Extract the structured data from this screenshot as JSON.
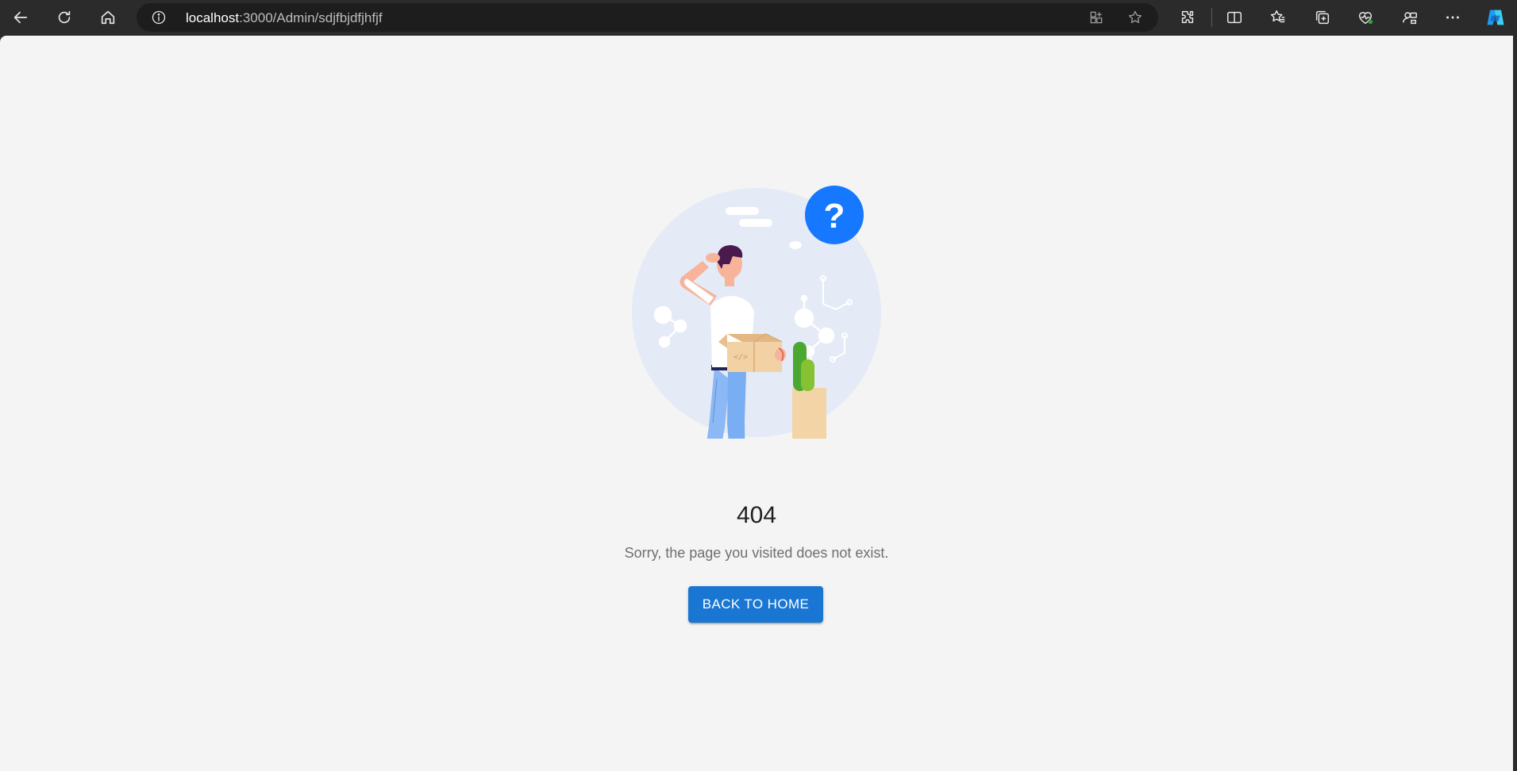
{
  "browser": {
    "url_host": "localhost",
    "url_path": ":3000/Admin/sdjfbjdfjhfjf",
    "toolbar_icons": [
      "back-icon",
      "refresh-icon",
      "home-icon",
      "info-icon",
      "app-available-icon",
      "favorite-star-icon",
      "extensions-icon",
      "split-screen-icon",
      "favorites-icon",
      "collections-icon",
      "browser-essentials-icon",
      "profile-sync-icon",
      "more-icon",
      "copilot-icon"
    ]
  },
  "error_page": {
    "code": "404",
    "message": "Sorry, the page you visited does not exist.",
    "button_label": "BACK TO HOME",
    "accent_color": "#1976d2",
    "illustration_icon": "person-holding-box-question-illustration"
  }
}
